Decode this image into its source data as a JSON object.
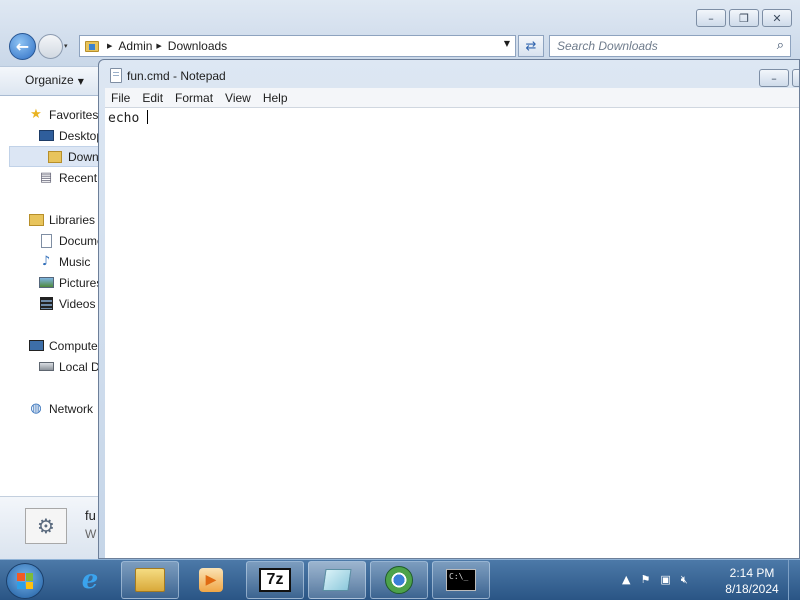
{
  "explorer": {
    "breadcrumb": [
      "Admin",
      "Downloads"
    ],
    "search_placeholder": "Search Downloads",
    "toolbar": {
      "organize_label": "Organize"
    },
    "nav_items": [
      {
        "label": "Favorites",
        "icon": "star-icon"
      },
      {
        "label": "Desktop",
        "icon": "desktop-icon"
      },
      {
        "label": "Downloads",
        "icon": "downloads-folder-icon",
        "selected": true
      },
      {
        "label": "Recent Places",
        "icon": "recent-places-icon"
      },
      {
        "label": "Libraries",
        "icon": "libraries-icon"
      },
      {
        "label": "Documents",
        "icon": "documents-icon"
      },
      {
        "label": "Music",
        "icon": "music-icon"
      },
      {
        "label": "Pictures",
        "icon": "pictures-icon"
      },
      {
        "label": "Videos",
        "icon": "videos-icon"
      },
      {
        "label": "Computer",
        "icon": "computer-icon"
      },
      {
        "label": "Local Disk (C:)",
        "icon": "disk-icon"
      },
      {
        "label": "Network",
        "icon": "network-icon"
      }
    ],
    "details": {
      "name": "fu",
      "type": "W"
    }
  },
  "notepad": {
    "title": "fun.cmd - Notepad",
    "menu": [
      "File",
      "Edit",
      "Format",
      "View",
      "Help"
    ],
    "content": "echo "
  },
  "taskbar": {
    "apps": [
      {
        "name": "internet-explorer-icon"
      },
      {
        "name": "file-explorer-icon"
      },
      {
        "name": "media-player-icon"
      },
      {
        "name": "7zip-icon",
        "label": "7z"
      },
      {
        "name": "notepad-icon"
      },
      {
        "name": "chrome-icon"
      },
      {
        "name": "command-prompt-icon",
        "label": "C:\\_"
      }
    ],
    "time": "2:14 PM",
    "date": "8/18/2024"
  },
  "colors": {
    "taskbar": "#2f5d8e",
    "selection": "#dce6f4",
    "accent": "#3c82cf"
  }
}
